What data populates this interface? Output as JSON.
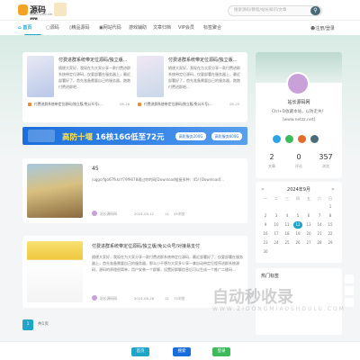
{
  "header": {
    "logo_text": "源码网",
    "logo_sub": "www.netzz.net",
    "search_placeholder": "搜索源码/教程/站长知识/文章",
    "search_icon": "search-icon"
  },
  "nav": {
    "items": [
      "首页",
      "源码",
      "精品源码",
      "网站代码",
      "游戏辅助",
      "文章归档",
      "VIP会员",
      "标签聚合"
    ],
    "login": "注册/登录"
  },
  "featured": [
    {
      "title": "付费进群系统带定位源码/独立版...",
      "excerpt": "随便大家好，我现在为大家分享一款付费进群系统带定位源码，仅要部署在服务器上，最近部署好了，首先准备需要自己的服务器，跑跑付费进群吧..."
    },
    {
      "title": "付费进群系统带定位源码/独立版...",
      "excerpt": "随便大家好，我现在为大家分享一款付费进群系统带定位源码，仅要部署在服务器上，最近部署好了，首先准备需要自己的服务器，跑跑付费进群吧..."
    }
  ],
  "featured_links": [
    {
      "title": "付费进群系统带定位源码/独立版/免公众号/...",
      "date": "08-26"
    },
    {
      "title": "付费进群系统带定位源码/独立版/免公众号/...",
      "date": "08-25"
    }
  ],
  "banner": {
    "text_a": "高防十堰",
    "text_b": "16核16G低至72元",
    "btn1": "高防服务200G",
    "btn2": "高防服务600G"
  },
  "posts": [
    {
      "title": "45",
      "excerpt": "/uggc/fgo67fkk/rf79f9678通过你的网[Download链接多种：45/ [Download]...",
      "author": "站长源码网",
      "date": "2024-09-12",
      "views": "11",
      "reads": "45浏览"
    },
    {
      "title": "付费进群系统带定位源码/独立版/免公众号/对接易支付",
      "excerpt": "随便大家好，我现在为大家分享一款付费进群系统带定位源码，最近部署好了，仅要部署在服务器上，首先准备需要自己的服务器，那么小不想为大家多少享一拿自动带定位程序进群系统源码，源码的原理很简单，用户安装一个群聊，设置好群聊信息后可以生成一个推广二维码...",
      "author": "站长源码网",
      "date": "2024-08-26",
      "views": "11",
      "reads": "75浏览"
    }
  ],
  "profile": {
    "name": "站长源码网",
    "desc": "Ctrl+D收藏本站，以防走失！",
    "url": "[www.netzz.net]",
    "stats": [
      {
        "num": "2",
        "label": "文章"
      },
      {
        "num": "0",
        "label": "评论"
      },
      {
        "num": "357",
        "label": "浏览"
      }
    ]
  },
  "calendar": {
    "title": "2024年9月",
    "weekdays": [
      "一",
      "二",
      "三",
      "四",
      "五",
      "六",
      "日"
    ],
    "days": [
      "",
      "",
      "",
      "",
      "",
      "",
      "1",
      "2",
      "3",
      "4",
      "5",
      "6",
      "7",
      "8",
      "9",
      "10",
      "11",
      "12",
      "13",
      "14",
      "15",
      "16",
      "17",
      "18",
      "19",
      "20",
      "21",
      "22",
      "23",
      "24",
      "25",
      "26",
      "27",
      "28",
      "29",
      "30"
    ],
    "today": "12"
  },
  "widget2_title": "热门标签",
  "pagination": {
    "current": "1",
    "total": "共1页"
  },
  "footer": {
    "btn1": "首页",
    "btn2": "搜索",
    "btn3": "登录"
  },
  "watermark": {
    "main": "自动秒收录",
    "sub": "WWW.ZIDONGMIAOSHOULU.COM"
  },
  "colors": {
    "accent": "#20a4c7",
    "banner": "#1a6edc",
    "orange": "#f08a30"
  }
}
